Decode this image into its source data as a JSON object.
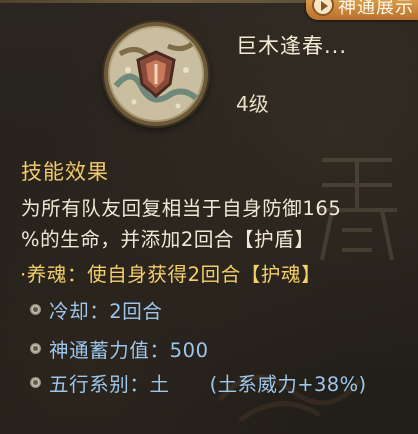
{
  "tab_badge": {
    "label": "神通展示",
    "icon": "play-icon",
    "color": "#c98539"
  },
  "skill": {
    "name": "巨木逢春...",
    "level": "4级",
    "icon": "shield-emblem-icon"
  },
  "effects": {
    "title": "技能效果",
    "description_lines": [
      "为所有队友回复相当于自身防御165",
      "%的生命，并添加2回合【护盾】"
    ],
    "sub_effect": "·养魂：使自身获得2回合【护魂】"
  },
  "stats": {
    "cooldown": "冷却：2回合",
    "charge": "神通蓄力值：500",
    "element": "五行系别：土",
    "element_bonus": "(土系威力+38%)"
  },
  "colors": {
    "title_gold": "#f1c96a",
    "stat_blue": "#9cc6ec",
    "text_light": "#f0e8d6"
  }
}
